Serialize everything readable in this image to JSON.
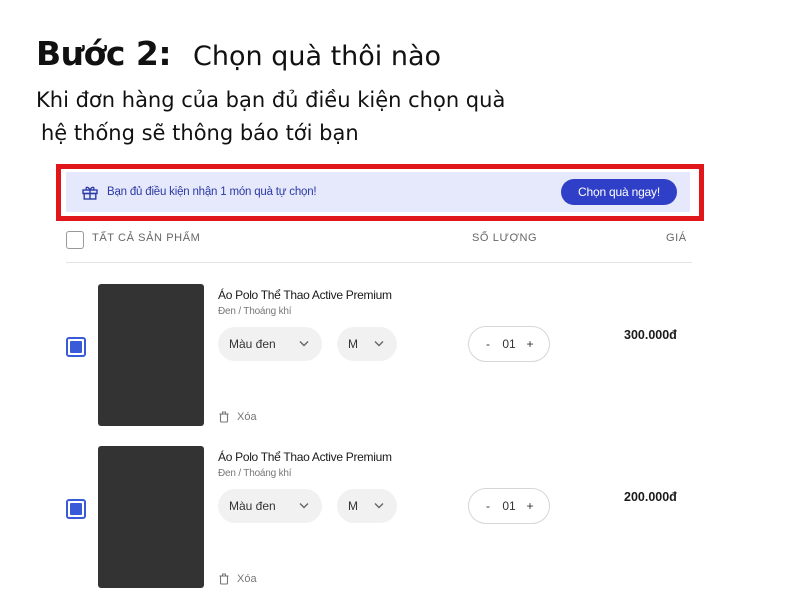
{
  "header": {
    "step_number": "Bước 2:",
    "step_title": "Chọn quà thôi nào",
    "intro_line1": "Khi đơn hàng của bạn đủ điều kiện chọn quà",
    "intro_line2": "hệ thống sẽ thông báo tới bạn"
  },
  "notice": {
    "icon": "gift-icon",
    "text": "Bạn đủ điều kiện nhận 1 món quà tự chọn!",
    "button_label": "Chọn quà ngay!",
    "highlight_color": "#e0161b",
    "background_color": "#e6e8fb",
    "button_color": "#2f3fc8"
  },
  "table": {
    "headers": {
      "all_products": "TẤT CẢ SẢN PHẨM",
      "quantity": "SỐ LƯỢNG",
      "price": "GIÁ"
    }
  },
  "items": [
    {
      "name": "Áo Polo Thể Thao Active Premium",
      "variant": "Đen  /  Thoáng khí",
      "color_option": "Màu đen",
      "size_option": "M",
      "quantity": "01",
      "price": "300.000đ",
      "remove_label": "Xóa",
      "checked": true
    },
    {
      "name": "Áo Polo Thể Thao Active Premium",
      "variant": "Đen  /  Thoáng khí",
      "color_option": "Màu đen",
      "size_option": "M",
      "quantity": "01",
      "price": "200.000đ",
      "remove_label": "Xóa",
      "checked": true
    }
  ],
  "stepper_labels": {
    "minus": "-",
    "plus": "+"
  },
  "accent_color": "#3a5bd8"
}
